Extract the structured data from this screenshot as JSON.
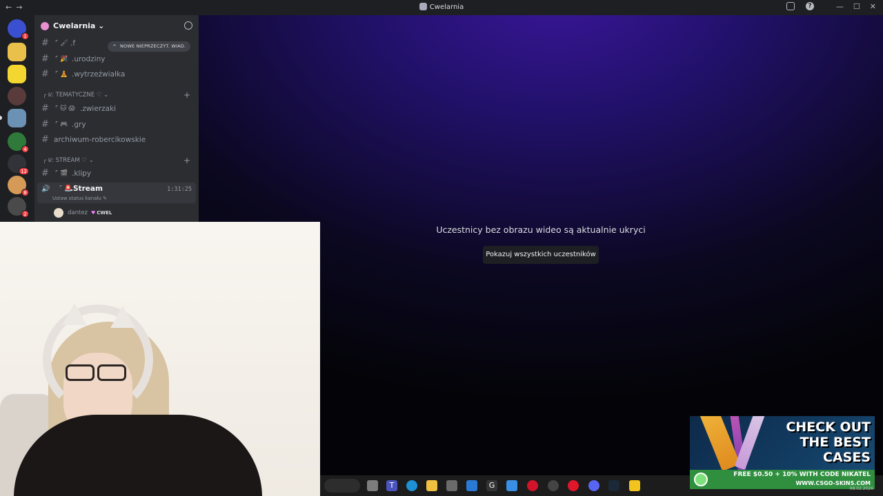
{
  "window": {
    "title": "Cwelarnia",
    "nav_back": "←",
    "nav_forward": "→",
    "help_icon": "?",
    "minimize": "—",
    "maximize": "☐",
    "close": "✕"
  },
  "servers": [
    {
      "badge": "1"
    },
    {
      "badge": ""
    },
    {
      "badge": ""
    },
    {
      "badge": ""
    },
    {
      "badge": ""
    },
    {
      "badge": "4"
    },
    {
      "badge": "12"
    },
    {
      "badge": "8"
    },
    {
      "badge": "2"
    }
  ],
  "guild": {
    "name": "Cwelarnia ⌄",
    "new_messages_label": "NOWE NIEPRZECZYT. WIAD."
  },
  "channels": [
    {
      "emoji": "⌜ 🖌",
      "name": ".f"
    },
    {
      "emoji": "⌜ 🎉",
      "name": ".urodziny"
    },
    {
      "emoji": "⌜ 🧘",
      "name": ".wytrzeźwiałka"
    }
  ],
  "category_tematyczne": {
    "label": "╭ ૪: TEMATYCZNE ♡ ⌄",
    "channels": [
      {
        "emoji": "⌜ 🐱 😱",
        "name": ".zwierzaki"
      },
      {
        "emoji": "⌜ 🎮",
        "name": ".gry"
      }
    ],
    "archive": "archiwum-robercikowskie"
  },
  "category_stream": {
    "label": "╭ ૪: STREAM ♡ ⌄",
    "channels": [
      {
        "emoji": "⌜ 🎬",
        "name": ".klipy"
      }
    ],
    "voice": {
      "emoji": "⌜ 🚨",
      "name": ".Stream",
      "status": "Ustaw status kanału ✎",
      "timer": "1:31:25"
    },
    "user": {
      "name": "dantez",
      "tag": "CWEL"
    }
  },
  "stage": {
    "message": "Uczestnicy bez obrazu wideo są aktualnie ukryci",
    "button": "Pokazuj wszystkich uczestników"
  },
  "ad": {
    "headline_1": "CHECK OUT",
    "headline_2": "THE BEST",
    "headline_3": "CASES",
    "promo": "FREE $0.50 + 10% WITH CODE NIKATEL",
    "url": "WWW.CSGO-SKINS.COM"
  },
  "taskbar": {
    "apps": [
      "file-explorer",
      "teams",
      "edge",
      "folder",
      "store",
      "mail",
      "logitech",
      "app",
      "opera",
      "clock",
      "opera-gx",
      "discord",
      "steam",
      "kodi"
    ],
    "clock": "08.02.2026"
  },
  "colors": {
    "accent": "#5865f2",
    "online": "#23a55a",
    "badge": "#f23f43"
  }
}
